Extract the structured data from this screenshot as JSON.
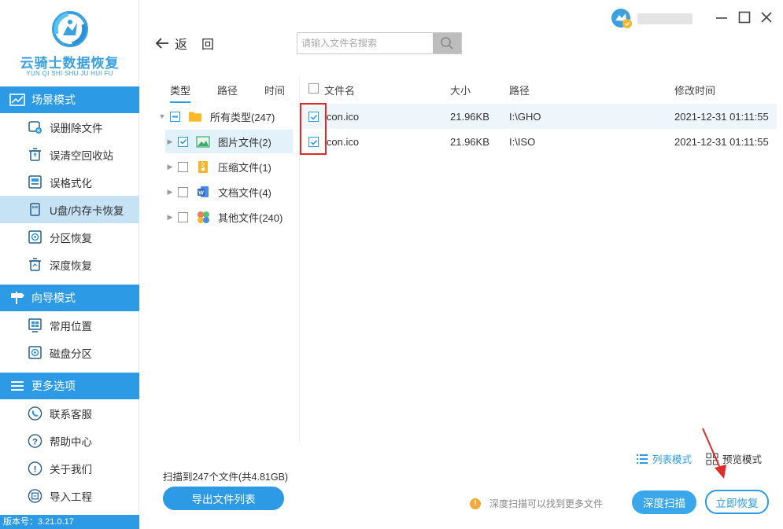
{
  "app": {
    "logo_title": "云骑士数据恢复",
    "logo_subtitle": "YUN QI SHI SHU JU HUI FU",
    "version": "版本号：3.21.0.17"
  },
  "sidebar": {
    "sections": [
      {
        "title": "场景模式",
        "icon": "scene-mode-icon",
        "items": [
          {
            "label": "误删除文件",
            "icon": "deleted-file-icon"
          },
          {
            "label": "误清空回收站",
            "icon": "recycle-bin-icon"
          },
          {
            "label": "误格式化",
            "icon": "format-icon"
          },
          {
            "label": "U盘/内存卡恢复",
            "icon": "usb-card-icon",
            "active": true
          },
          {
            "label": "分区恢复",
            "icon": "partition-icon"
          },
          {
            "label": "深度恢复",
            "icon": "deep-recover-icon"
          }
        ]
      },
      {
        "title": "向导模式",
        "icon": "guide-mode-icon",
        "items": [
          {
            "label": "常用位置",
            "icon": "common-location-icon"
          },
          {
            "label": "磁盘分区",
            "icon": "disk-partition-icon"
          }
        ]
      },
      {
        "title": "更多选项",
        "icon": "menu-icon",
        "items": [
          {
            "label": "联系客服",
            "icon": "customer-service-icon"
          },
          {
            "label": "帮助中心",
            "icon": "help-icon"
          },
          {
            "label": "关于我们",
            "icon": "info-icon"
          },
          {
            "label": "导入工程",
            "icon": "import-project-icon"
          }
        ]
      }
    ]
  },
  "topbar": {
    "back_label_1": "返",
    "back_label_2": "回",
    "search_placeholder": "请输入文件名搜索"
  },
  "tree": {
    "tabs": [
      "类型",
      "路径",
      "时间"
    ],
    "rows": [
      {
        "label": "所有类型(247)",
        "icon": "folder-icon",
        "check": "partial",
        "expanded": true
      },
      {
        "label": "图片文件(2)",
        "icon": "image-file-icon",
        "check": "checked",
        "selected": true
      },
      {
        "label": "压缩文件(1)",
        "icon": "zip-file-icon",
        "check": "unchecked"
      },
      {
        "label": "文档文件(4)",
        "icon": "document-file-icon",
        "check": "unchecked"
      },
      {
        "label": "其他文件(240)",
        "icon": "other-file-icon",
        "check": "unchecked"
      }
    ]
  },
  "filelist": {
    "columns": [
      "文件名",
      "大小",
      "路径",
      "修改时间"
    ],
    "rows": [
      {
        "name": "icon.ico",
        "size": "21.96KB",
        "path": "I:\\GHO",
        "mtime": "2021-12-31 01:11:55",
        "checked": true
      },
      {
        "name": "icon.ico",
        "size": "21.96KB",
        "path": "I:\\ISO",
        "mtime": "2021-12-31 01:11:55",
        "checked": true
      }
    ]
  },
  "footer": {
    "scan_info": "扫描到247个文件(共4.81GB)",
    "export_label": "导出文件列表",
    "hint": "深度扫描可以找到更多文件",
    "deep_scan_label": "深度扫描",
    "recover_label": "立即恢复",
    "list_mode_label": "列表模式",
    "preview_mode_label": "预览模式"
  },
  "colors": {
    "accent": "#2d9ae6",
    "highlight_box": "#e02b2b",
    "hint_icon": "#f3a93b"
  }
}
